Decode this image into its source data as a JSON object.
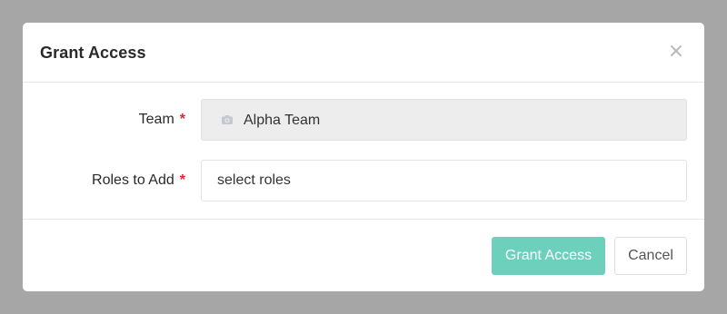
{
  "modal": {
    "title": "Grant Access",
    "close_symbol": "×"
  },
  "form": {
    "team": {
      "label": "Team",
      "required_mark": "*",
      "value": "Alpha Team",
      "icon": "camera-icon",
      "disabled": true
    },
    "roles": {
      "label": "Roles to Add",
      "required_mark": "*",
      "placeholder": "select roles"
    }
  },
  "footer": {
    "primary_label": "Grant Access",
    "secondary_label": "Cancel"
  },
  "colors": {
    "overlay": "#a6a6a6",
    "primary_button": "#6dd0bd",
    "required": "#e5232d"
  }
}
